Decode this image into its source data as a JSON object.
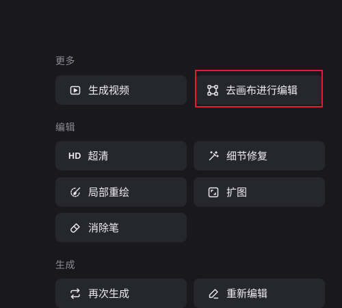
{
  "sections": {
    "more": {
      "title": "更多",
      "items": [
        {
          "label": "生成视频",
          "icon": "video-icon"
        },
        {
          "label": "去画布进行编辑",
          "icon": "canvas-crop-icon"
        }
      ]
    },
    "edit": {
      "title": "编辑",
      "items": [
        {
          "label": "超清",
          "icon": "hd-icon",
          "icon_text": "HD"
        },
        {
          "label": "细节修复",
          "icon": "magic-wand-icon"
        },
        {
          "label": "局部重绘",
          "icon": "brush-icon"
        },
        {
          "label": "扩图",
          "icon": "expand-icon"
        },
        {
          "label": "消除笔",
          "icon": "eraser-icon"
        }
      ]
    },
    "generate": {
      "title": "生成",
      "items": [
        {
          "label": "再次生成",
          "icon": "repeat-icon"
        },
        {
          "label": "重新编辑",
          "icon": "pen-icon"
        }
      ]
    }
  },
  "colors": {
    "background": "#19191d",
    "tile": "#26272d",
    "highlight": "#e0202a",
    "section_label": "#8b8c95"
  }
}
